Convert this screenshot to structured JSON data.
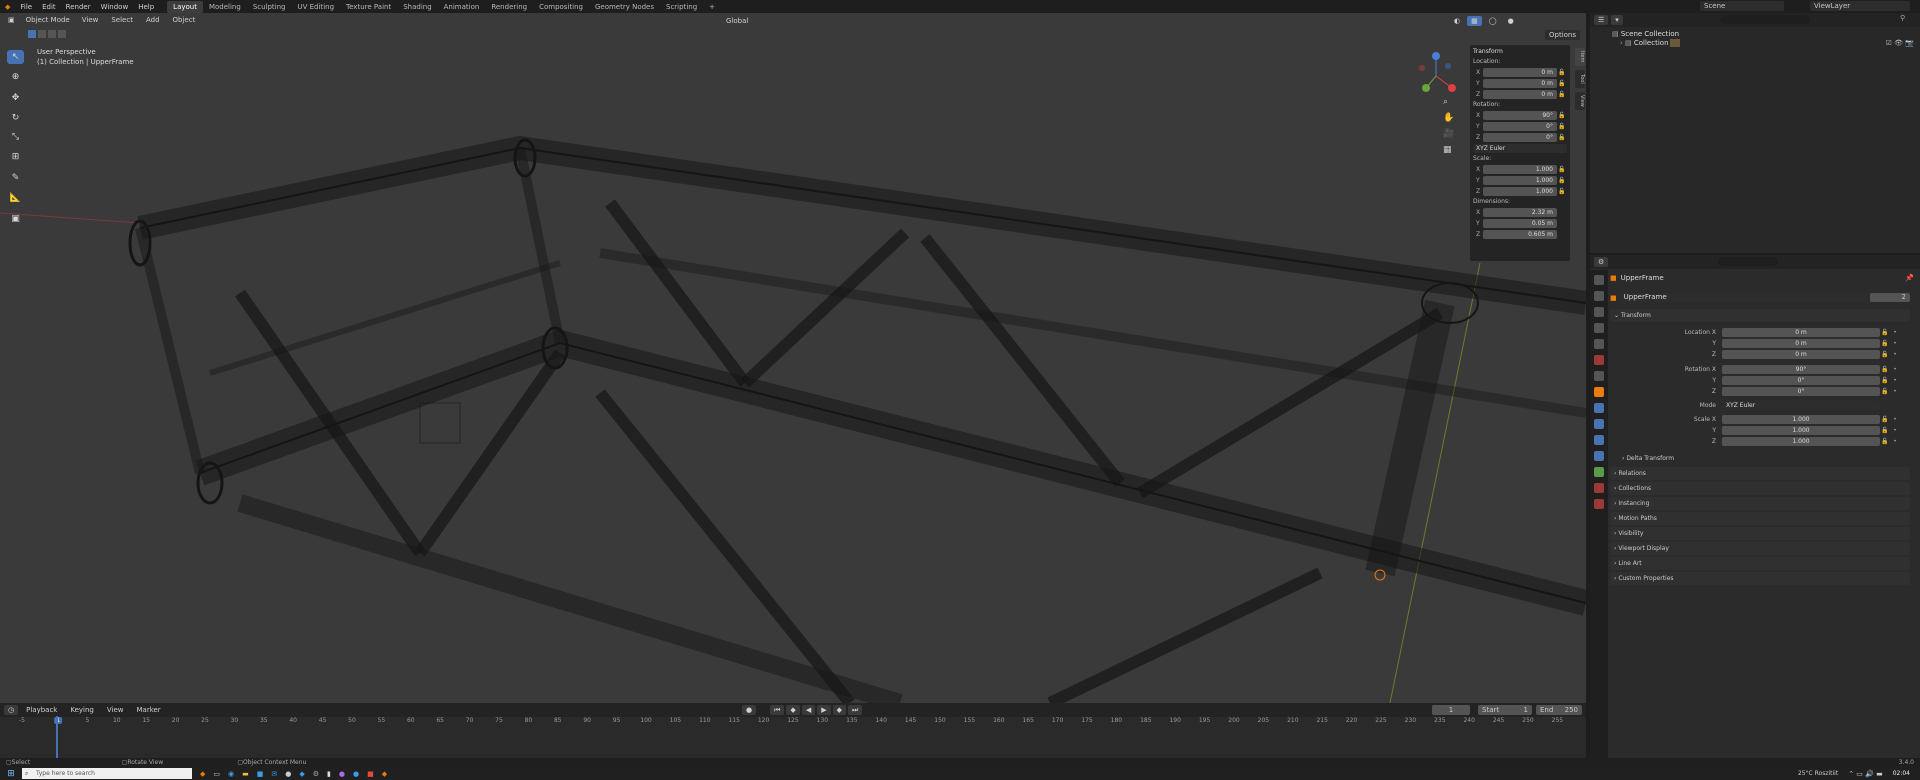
{
  "menubar": {
    "items": [
      "File",
      "Edit",
      "Render",
      "Window",
      "Help"
    ],
    "workspaces": [
      "Layout",
      "Modeling",
      "Sculpting",
      "UV Editing",
      "Texture Paint",
      "Shading",
      "Animation",
      "Rendering",
      "Compositing",
      "Geometry Nodes",
      "Scripting"
    ],
    "active_workspace": "Layout",
    "add_tab": "+",
    "scene": "Scene",
    "view_layer": "ViewLayer"
  },
  "viewport": {
    "mode": "Object Mode",
    "menus": [
      "View",
      "Select",
      "Add",
      "Object"
    ],
    "orientation": "Global",
    "options": "Options",
    "perspective_label": "User Perspective",
    "collection_label": "(1) Collection | UpperFrame"
  },
  "npanel": {
    "title": "Transform",
    "location_label": "Location:",
    "location": {
      "x": "0 m",
      "y": "0 m",
      "z": "0 m"
    },
    "rotation_label": "Rotation:",
    "rotation": {
      "x": "90°",
      "y": "0°",
      "z": "0°"
    },
    "rotation_mode": "XYZ Euler",
    "scale_label": "Scale:",
    "scale": {
      "x": "1.000",
      "y": "1.000",
      "z": "1.000"
    },
    "dimensions_label": "Dimensions:",
    "dimensions": {
      "x": "2.32 m",
      "y": "0.05 m",
      "z": "0.605 m"
    },
    "axes": [
      "X",
      "Y",
      "Z"
    ],
    "tabs": [
      "Item",
      "Tool",
      "View"
    ]
  },
  "outliner": {
    "scene_collection": "Scene Collection",
    "collection": "Collection"
  },
  "properties": {
    "object_name": "UpperFrame",
    "data_name": "UpperFrame",
    "users": "2",
    "transform_label": "Transform",
    "location_x_label": "Location X",
    "location": [
      "0 m",
      "0 m",
      "0 m"
    ],
    "rotation_x_label": "Rotation X",
    "rotation": [
      "90°",
      "0°",
      "0°"
    ],
    "mode_label": "Mode",
    "mode": "XYZ Euler",
    "scale_x_label": "Scale X",
    "scale": [
      "1.000",
      "1.000",
      "1.000"
    ],
    "y_label": "Y",
    "z_label": "Z",
    "delta": "Delta Transform",
    "sections": [
      "Relations",
      "Collections",
      "Instancing",
      "Motion Paths",
      "Visibility",
      "Viewport Display",
      "Line Art",
      "Custom Properties"
    ]
  },
  "timeline": {
    "menus": [
      "Playback",
      "Keying",
      "View",
      "Marker"
    ],
    "current_frame": "1",
    "start_label": "Start",
    "start": "1",
    "end_label": "End",
    "end": "250",
    "ticks": [
      "-5",
      "1",
      "5",
      "10",
      "15",
      "20",
      "25",
      "30",
      "35",
      "40",
      "45",
      "50",
      "55",
      "60",
      "65",
      "70",
      "75",
      "80",
      "85",
      "90",
      "95",
      "100",
      "105",
      "110",
      "115",
      "120",
      "125",
      "130",
      "135",
      "140",
      "145",
      "150",
      "155",
      "160",
      "165",
      "170",
      "175",
      "180",
      "185",
      "190",
      "195",
      "200",
      "205",
      "210",
      "215",
      "220",
      "225",
      "230",
      "235",
      "240",
      "245",
      "250",
      "255"
    ]
  },
  "statusbar": {
    "select": "Select",
    "rotate": "Rotate View",
    "context": "Object Context Menu",
    "version": "3.4.0"
  },
  "taskbar": {
    "search_placeholder": "Type here to search",
    "weather": "25°C Roszitiit",
    "time": "02:04"
  }
}
